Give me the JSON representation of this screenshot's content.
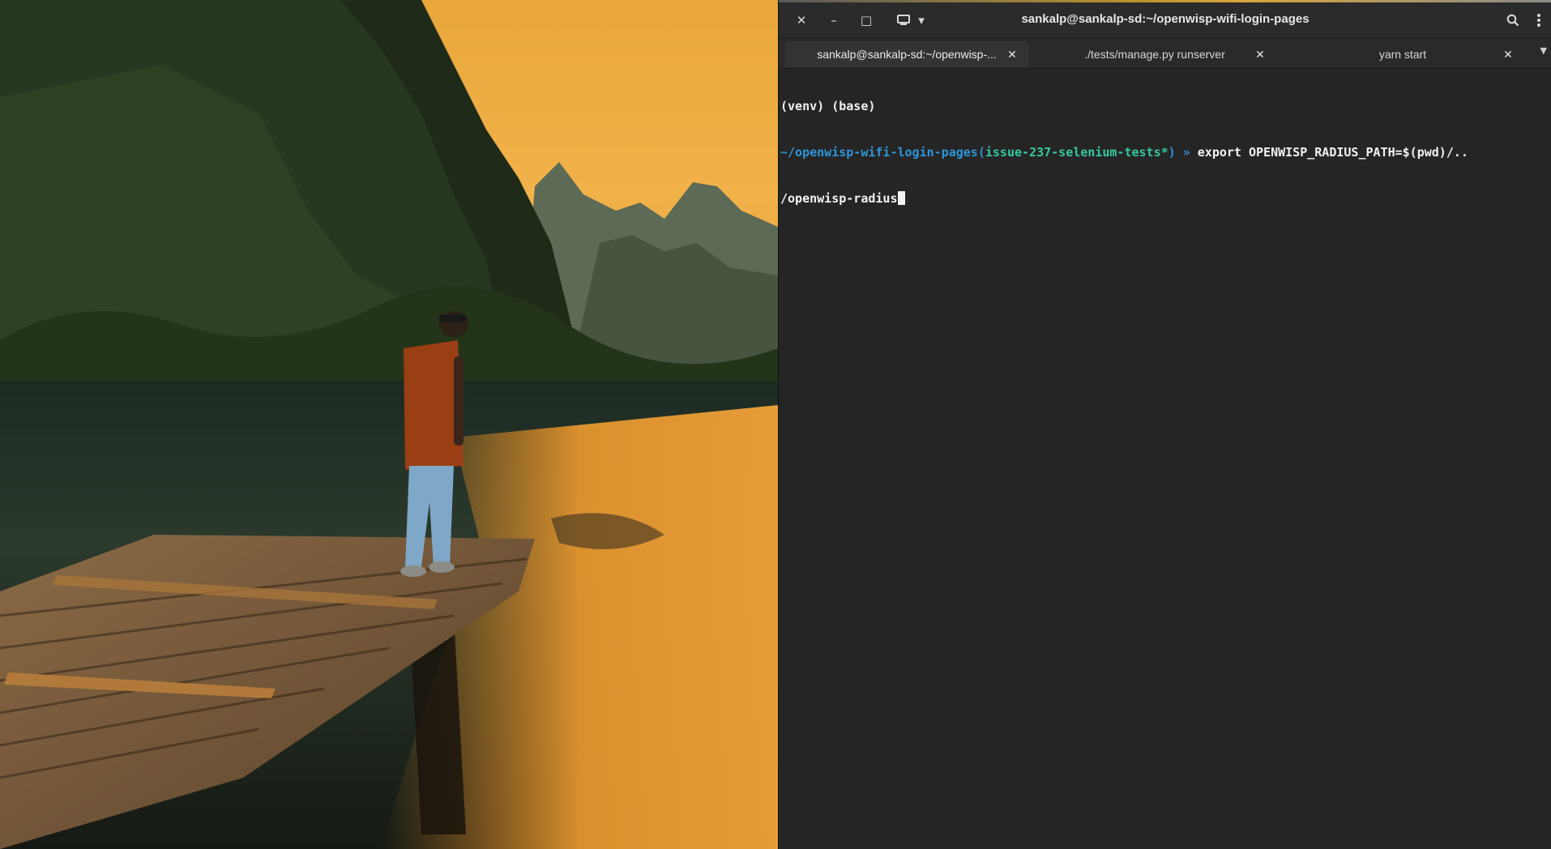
{
  "window": {
    "title": "sankalp@sankalp-sd:~/openwisp-wifi-login-pages",
    "controls": {
      "close_icon": "close-icon",
      "minimize_icon": "minimize-icon",
      "maximize_icon": "maximize-icon",
      "new_tab_icon": "new-tab-icon",
      "menu_icon": "chevron-down-icon",
      "search_icon": "search-icon",
      "kebab_icon": "kebab-menu-icon"
    },
    "glyphs": {
      "close": "✕",
      "minimize": "–",
      "maximize": "□",
      "dropdown": "▾",
      "tab_close": "✕",
      "tabs_menu": "▼"
    }
  },
  "tabs": [
    {
      "label": "sankalp@sankalp-sd:~/openwisp-...",
      "active": true
    },
    {
      "label": "./tests/manage.py runserver",
      "active": false
    },
    {
      "label": "yarn start",
      "active": false
    }
  ],
  "terminal": {
    "line1": "(venv) (base)",
    "line2": {
      "path": "~/openwisp-wifi-login-pages",
      "paren_open": "(",
      "branch": "issue-237-selenium-tests*",
      "paren_close": ")",
      "prompt": " » ",
      "command": "export OPENWISP_RADIUS_PATH=$(pwd)/.."
    },
    "line3": "/openwisp-radius"
  },
  "colors": {
    "path": "#2f95d6",
    "branch": "#35c7a3",
    "prompt": "#3b8bd0",
    "text": "#f2f2f2",
    "terminal_bg": "#252525"
  }
}
